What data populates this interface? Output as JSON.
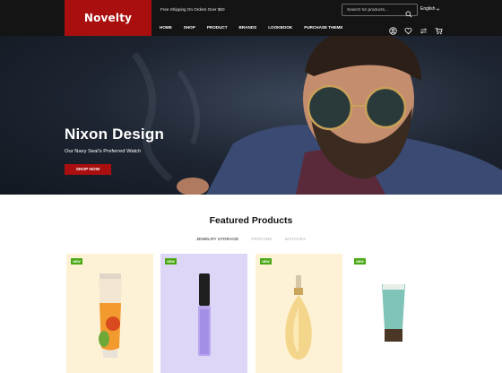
{
  "brand": {
    "name": "Novelty",
    "color": "#a90f0f"
  },
  "topbar": {
    "shipping_text": "Free Shipping On Orders Over $50",
    "search_placeholder": "Search for products...",
    "language": "English"
  },
  "nav": {
    "items": [
      {
        "label": "HOME"
      },
      {
        "label": "SHOP"
      },
      {
        "label": "PRODUCT"
      },
      {
        "label": "BRANDS"
      },
      {
        "label": "LOOKBOOK"
      },
      {
        "label": "PURCHASE THEME"
      }
    ],
    "icons": [
      "user-icon",
      "heart-icon",
      "compare-icon",
      "cart-icon"
    ]
  },
  "hero": {
    "title": "Nixon Design",
    "subtitle": "Our Navy Seal's Preferred Watch",
    "button_label": "SHOP NOW",
    "slide_count": 2,
    "active_slide": 1
  },
  "featured": {
    "title": "Featured Products",
    "tabs": [
      {
        "label": "JEWELRY STORAGE",
        "active": true
      },
      {
        "label": "PERFUME",
        "active": false
      },
      {
        "label": "WATCHES",
        "active": false
      }
    ],
    "products": [
      {
        "badge": "NEW",
        "bg": "#fdf2d5"
      },
      {
        "badge": "NEW",
        "bg": "#ded6f7"
      },
      {
        "badge": "NEW",
        "bg": "#fdf2d5"
      },
      {
        "badge": "NEW",
        "bg": "#ffffff"
      }
    ],
    "badge_color": "#49a813"
  }
}
